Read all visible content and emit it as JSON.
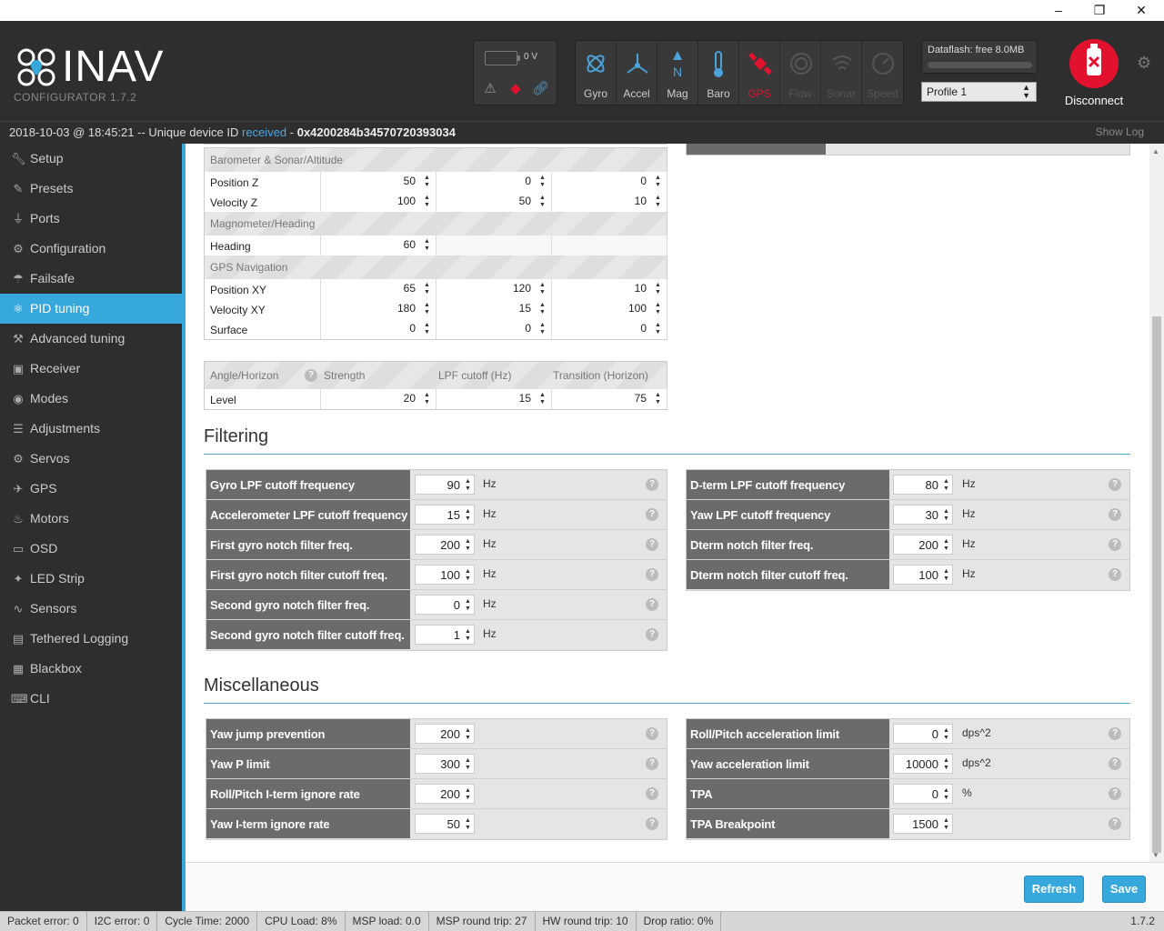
{
  "window": {
    "minimize": "–",
    "maximize": "❐",
    "close": "✕"
  },
  "header": {
    "logo_word": "INAV",
    "logo_sub": "CONFIGURATOR  1.7.2",
    "battery_voltage": "0 V",
    "sensors": [
      {
        "label": "Gyro",
        "icon": "gyro-icon",
        "state": "active"
      },
      {
        "label": "Accel",
        "icon": "accel-icon",
        "state": "active"
      },
      {
        "label": "Mag",
        "icon": "mag-icon",
        "state": "active"
      },
      {
        "label": "Baro",
        "icon": "baro-icon",
        "state": "active"
      },
      {
        "label": "GPS",
        "icon": "gps-icon",
        "state": "error"
      },
      {
        "label": "Flow",
        "icon": "flow-icon",
        "state": "off"
      },
      {
        "label": "Sonar",
        "icon": "sonar-icon",
        "state": "off"
      },
      {
        "label": "Speed",
        "icon": "speed-icon",
        "state": "off"
      }
    ],
    "dataflash": "Dataflash: free 8.0MB",
    "profile": "Profile 1",
    "disconnect": "Disconnect"
  },
  "status": {
    "datetime": "2018-10-03 @ 18:45:21 -- Unique device ID ",
    "received": "received",
    "dash": " - ",
    "device_id": "0x4200284b34570720393034",
    "show_log": "Show Log"
  },
  "nav": [
    {
      "label": "Setup",
      "icon": "wrench-icon"
    },
    {
      "label": "Presets",
      "icon": "presets-icon"
    },
    {
      "label": "Ports",
      "icon": "plug-icon"
    },
    {
      "label": "Configuration",
      "icon": "gear-icon"
    },
    {
      "label": "Failsafe",
      "icon": "parachute-icon"
    },
    {
      "label": "PID tuning",
      "icon": "pid-icon",
      "active": true
    },
    {
      "label": "Advanced tuning",
      "icon": "advanced-tuning-icon"
    },
    {
      "label": "Receiver",
      "icon": "receiver-icon"
    },
    {
      "label": "Modes",
      "icon": "modes-icon"
    },
    {
      "label": "Adjustments",
      "icon": "sliders-icon"
    },
    {
      "label": "Servos",
      "icon": "servo-icon"
    },
    {
      "label": "GPS",
      "icon": "satellite-icon"
    },
    {
      "label": "Motors",
      "icon": "motor-icon"
    },
    {
      "label": "OSD",
      "icon": "osd-icon"
    },
    {
      "label": "LED Strip",
      "icon": "led-icon"
    },
    {
      "label": "Sensors",
      "icon": "pulse-icon"
    },
    {
      "label": "Tethered Logging",
      "icon": "log-icon"
    },
    {
      "label": "Blackbox",
      "icon": "blackbox-icon"
    },
    {
      "label": "CLI",
      "icon": "terminal-icon"
    }
  ],
  "pid": {
    "groups": [
      {
        "title": "Barometer & Sonar/Altitude",
        "rows": [
          {
            "name": "Position Z",
            "values": [
              "50",
              "0",
              "0"
            ]
          },
          {
            "name": "Velocity Z",
            "values": [
              "100",
              "50",
              "10"
            ]
          }
        ]
      },
      {
        "title": "Magnometer/Heading",
        "rows": [
          {
            "name": "Heading",
            "values": [
              "60",
              null,
              null
            ]
          }
        ]
      },
      {
        "title": "GPS Navigation",
        "rows": [
          {
            "name": "Position XY",
            "values": [
              "65",
              "120",
              "10"
            ]
          },
          {
            "name": "Velocity XY",
            "values": [
              "180",
              "15",
              "100"
            ]
          },
          {
            "name": "Surface",
            "values": [
              "0",
              "0",
              "0"
            ]
          }
        ]
      }
    ],
    "level_table": {
      "headers": [
        "Angle/Horizon",
        "Strength",
        "LPF cutoff (Hz)",
        "Transition (Horizon)"
      ],
      "row": {
        "name": "Level",
        "values": [
          "20",
          "15",
          "75"
        ]
      }
    }
  },
  "filtering": {
    "title": "Filtering",
    "left": [
      {
        "label": "Gyro LPF cutoff frequency",
        "value": "90",
        "unit": "Hz"
      },
      {
        "label": "Accelerometer LPF cutoff frequency",
        "value": "15",
        "unit": "Hz"
      },
      {
        "label": "First gyro notch filter freq.",
        "value": "200",
        "unit": "Hz"
      },
      {
        "label": "First gyro notch filter cutoff freq.",
        "value": "100",
        "unit": "Hz"
      },
      {
        "label": "Second gyro notch filter freq.",
        "value": "0",
        "unit": "Hz"
      },
      {
        "label": "Second gyro notch filter cutoff freq.",
        "value": "1",
        "unit": "Hz"
      }
    ],
    "right": [
      {
        "label": "D-term LPF cutoff frequency",
        "value": "80",
        "unit": "Hz"
      },
      {
        "label": "Yaw LPF cutoff frequency",
        "value": "30",
        "unit": "Hz"
      },
      {
        "label": "Dterm notch filter freq.",
        "value": "200",
        "unit": "Hz"
      },
      {
        "label": "Dterm notch filter cutoff freq.",
        "value": "100",
        "unit": "Hz"
      }
    ]
  },
  "misc": {
    "title": "Miscellaneous",
    "left": [
      {
        "label": "Yaw jump prevention",
        "value": "200",
        "unit": ""
      },
      {
        "label": "Yaw P limit",
        "value": "300",
        "unit": ""
      },
      {
        "label": "Roll/Pitch I-term ignore rate",
        "value": "200",
        "unit": ""
      },
      {
        "label": "Yaw I-term ignore rate",
        "value": "50",
        "unit": ""
      }
    ],
    "right": [
      {
        "label": "Roll/Pitch acceleration limit",
        "value": "0",
        "unit": "dps^2"
      },
      {
        "label": "Yaw acceleration limit",
        "value": "10000",
        "unit": "dps^2"
      },
      {
        "label": "TPA",
        "value": "0",
        "unit": "%"
      },
      {
        "label": "TPA Breakpoint",
        "value": "1500",
        "unit": ""
      }
    ]
  },
  "buttons": {
    "refresh": "Refresh",
    "save": "Save"
  },
  "footer": {
    "items": [
      "Packet error: 0",
      "I2C error: 0",
      "Cycle Time: 2000",
      "CPU Load: 8%",
      "MSP load: 0.0",
      "MSP round trip: 27",
      "HW round trip: 10",
      "Drop ratio: 0%"
    ],
    "version": "1.7.2"
  },
  "colors": {
    "accent": "#37a8db",
    "header_bg": "#2e2e2e",
    "sensor_active": "#4aa3d9",
    "sensor_error": "#e2122f",
    "disconnect": "#e2122f"
  }
}
